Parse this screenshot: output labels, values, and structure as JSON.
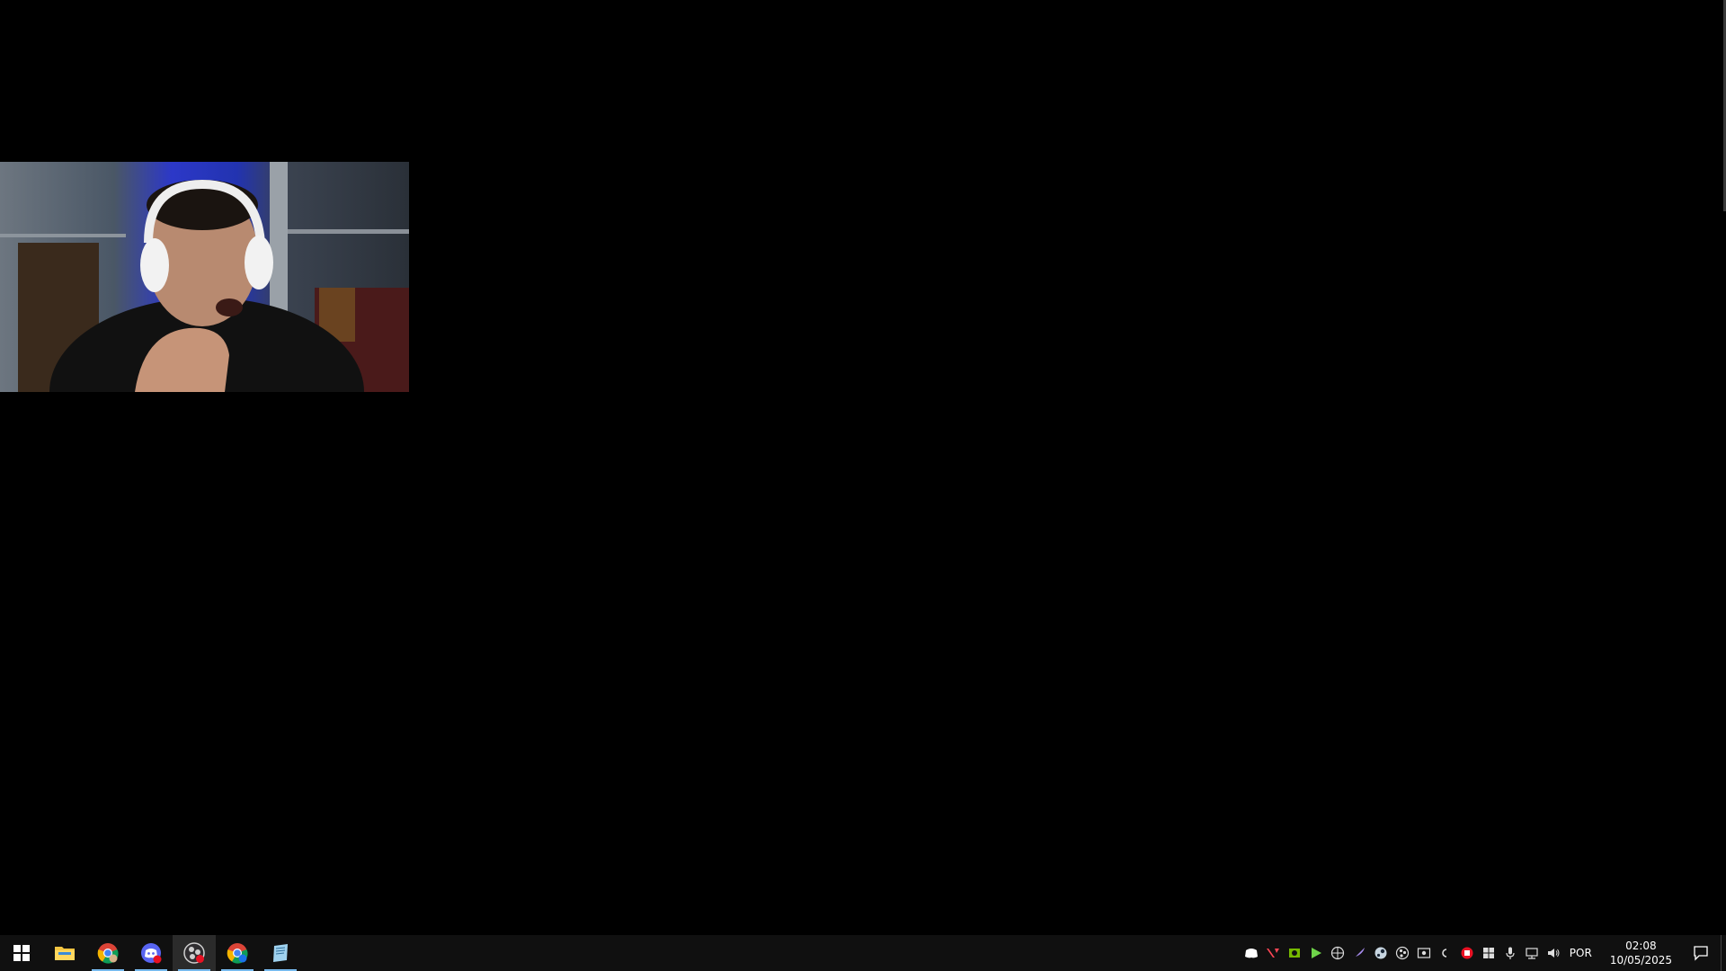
{
  "webcam": {
    "description_icon": "webcam-feed"
  },
  "taskbar": {
    "apps": [
      {
        "name": "start-button",
        "icon": "windows-logo-icon"
      },
      {
        "name": "file-explorer",
        "icon": "folder-icon"
      },
      {
        "name": "chrome-1",
        "icon": "chrome-icon"
      },
      {
        "name": "discord",
        "icon": "discord-icon"
      },
      {
        "name": "obs",
        "icon": "obs-icon"
      },
      {
        "name": "chrome-2",
        "icon": "chrome-icon"
      },
      {
        "name": "notes",
        "icon": "notepad-icon"
      }
    ],
    "tray": {
      "language": "POR",
      "time": "02:08",
      "date": "10/05/2025"
    }
  },
  "colors": {
    "taskbar_bg": "#101010",
    "running_indicator": "#76b9ed",
    "obs_badge": "#e81123"
  }
}
